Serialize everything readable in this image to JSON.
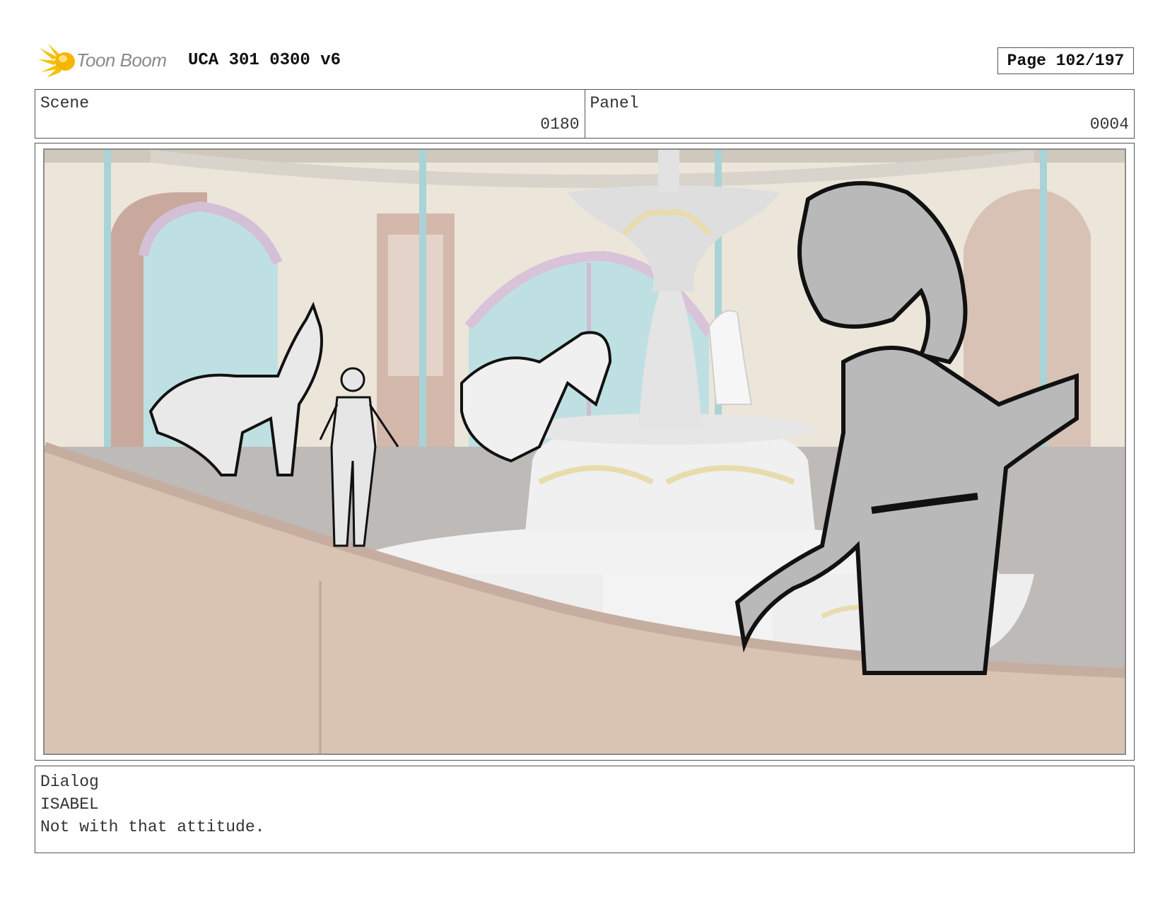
{
  "header": {
    "logo_text": "Toon Boom",
    "doc_title": "UCA 301 0300 v6",
    "page_label": "Page 102/197"
  },
  "scene": {
    "label": "Scene",
    "value": "0180"
  },
  "panel": {
    "label": "Panel",
    "value": "0004"
  },
  "dialog": {
    "label": "Dialog",
    "character": "ISABEL",
    "line": "Not with that attitude."
  },
  "colors": {
    "logo_accent": "#f4c20d",
    "frame_border": "#555555",
    "wall": "#ece6da",
    "railing": "#d9c3b3",
    "fountain": "#ececec",
    "gold_trim": "#e8dcae",
    "sky_window": "#bfe0e2",
    "sketch_gray": "#b9b9b9"
  },
  "icons": {
    "logo": "toon-boom-burst-icon"
  }
}
